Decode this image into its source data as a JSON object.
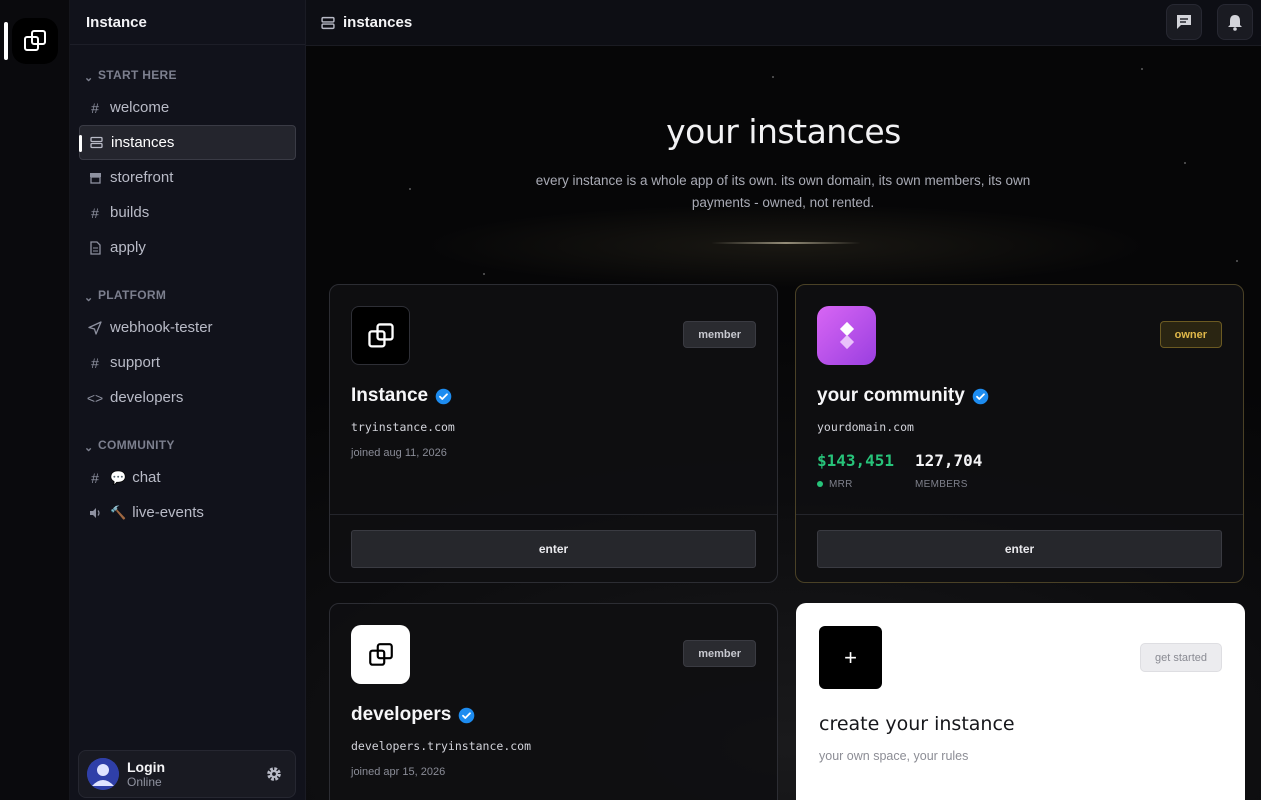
{
  "sidebar": {
    "server_name": "Instance",
    "categories": [
      {
        "label": "START HERE",
        "items": [
          {
            "label": "welcome",
            "icon": "hash"
          },
          {
            "label": "instances",
            "icon": "server-stack",
            "active": true
          },
          {
            "label": "storefront",
            "icon": "store"
          },
          {
            "label": "builds",
            "icon": "hash"
          },
          {
            "label": "apply",
            "icon": "document"
          }
        ]
      },
      {
        "label": "PLATFORM",
        "items": [
          {
            "label": "webhook-tester",
            "icon": "send"
          },
          {
            "label": "support",
            "icon": "hash"
          },
          {
            "label": "developers",
            "icon": "code"
          }
        ]
      },
      {
        "label": "COMMUNITY",
        "items": [
          {
            "label": "chat",
            "icon": "hash",
            "emoji": "💬"
          },
          {
            "label": "live-events",
            "icon": "speaker",
            "emoji": "🔨"
          }
        ]
      }
    ],
    "user": {
      "name": "Login",
      "status": "Online"
    }
  },
  "topbar": {
    "title": "instances"
  },
  "hero": {
    "title": "your instances",
    "subtitle": "every instance is a whole app of its own. its own domain, its own members, its own payments - owned, not rented."
  },
  "cards": [
    {
      "name": "Instance",
      "domain": "tryinstance.com",
      "joined": "joined aug 11, 2026",
      "role": "member",
      "button": "enter"
    },
    {
      "name": "your community",
      "domain": "yourdomain.com",
      "role": "owner",
      "mrr": "$143,451",
      "mrr_label": "MRR",
      "members": "127,704",
      "members_label": "MEMBERS",
      "button": "enter"
    },
    {
      "name": "developers",
      "domain": "developers.tryinstance.com",
      "joined": "joined apr 15, 2026",
      "role": "member"
    }
  ],
  "create": {
    "plus": "+",
    "button": "get started",
    "title": "create your instance",
    "subtitle": "your own space, your rules"
  },
  "colors": {
    "accent_green": "#27c37a",
    "owner_gold": "#e1b94a",
    "verify_blue": "#1d8cf0"
  }
}
